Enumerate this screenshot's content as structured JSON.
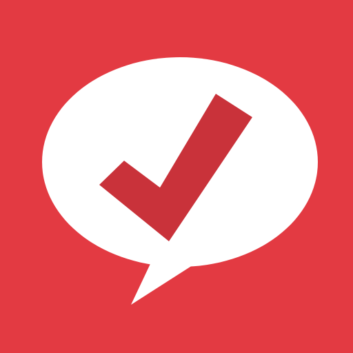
{
  "icon": {
    "name": "speech-bubble-checkmark-icon",
    "background_color": "#e33a42",
    "bubble_color": "#ffffff",
    "check_color": "#c9323a"
  }
}
